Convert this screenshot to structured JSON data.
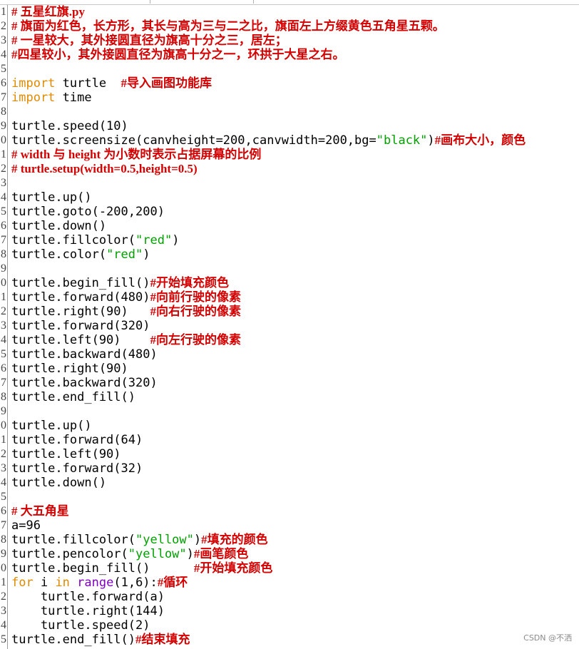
{
  "editor": {
    "watermark": "CSDN @不洒",
    "lines": [
      {
        "num": "1",
        "segs": [
          {
            "t": "# 五星红旗.py",
            "c": "comment"
          }
        ]
      },
      {
        "num": "2",
        "segs": [
          {
            "t": "# 旗面为红色，长方形，其长与高为三与二之比，旗面左上方缀黄色五角星五颗。",
            "c": "comment"
          }
        ]
      },
      {
        "num": "3",
        "segs": [
          {
            "t": "# 一星较大，其外接圆直径为旗高十分之三，居左；",
            "c": "comment"
          }
        ]
      },
      {
        "num": "4",
        "segs": [
          {
            "t": "#四星较小，其外接圆直径为旗高十分之一，环拱于大星之右。",
            "c": "comment"
          }
        ]
      },
      {
        "num": "5",
        "segs": []
      },
      {
        "num": "6",
        "segs": [
          {
            "t": "import",
            "c": "kw"
          },
          {
            "t": " turtle  ",
            "c": "plain"
          },
          {
            "t": "#导入画图功能库",
            "c": "comment"
          }
        ]
      },
      {
        "num": "7",
        "segs": [
          {
            "t": "import",
            "c": "kw"
          },
          {
            "t": " time",
            "c": "plain"
          }
        ]
      },
      {
        "num": "8",
        "segs": []
      },
      {
        "num": "9",
        "segs": [
          {
            "t": "turtle.speed(10)",
            "c": "plain"
          }
        ]
      },
      {
        "num": "0",
        "segs": [
          {
            "t": "turtle.screensize(canvheight=200,canvwidth=200,bg=",
            "c": "plain"
          },
          {
            "t": "\"black\"",
            "c": "str"
          },
          {
            "t": ")",
            "c": "plain"
          },
          {
            "t": "#画布大小，颜色",
            "c": "comment"
          }
        ]
      },
      {
        "num": "1",
        "segs": [
          {
            "t": "# width 与 height 为小数时表示占据屏幕的比例",
            "c": "comment"
          }
        ]
      },
      {
        "num": "2",
        "segs": [
          {
            "t": "# turtle.setup(width=0.5,height=0.5)",
            "c": "comment"
          }
        ]
      },
      {
        "num": "3",
        "segs": []
      },
      {
        "num": "4",
        "segs": [
          {
            "t": "turtle.up()",
            "c": "plain"
          }
        ]
      },
      {
        "num": "5",
        "segs": [
          {
            "t": "turtle.goto(-200,200)",
            "c": "plain"
          }
        ]
      },
      {
        "num": "6",
        "segs": [
          {
            "t": "turtle.down()",
            "c": "plain"
          }
        ]
      },
      {
        "num": "7",
        "segs": [
          {
            "t": "turtle.fillcolor(",
            "c": "plain"
          },
          {
            "t": "\"red\"",
            "c": "str"
          },
          {
            "t": ")",
            "c": "plain"
          }
        ]
      },
      {
        "num": "8",
        "segs": [
          {
            "t": "turtle.color(",
            "c": "plain"
          },
          {
            "t": "\"red\"",
            "c": "str"
          },
          {
            "t": ")",
            "c": "plain"
          }
        ]
      },
      {
        "num": "9",
        "segs": []
      },
      {
        "num": "0",
        "segs": [
          {
            "t": "turtle.begin_fill()",
            "c": "plain"
          },
          {
            "t": "#开始填充颜色",
            "c": "comment"
          }
        ]
      },
      {
        "num": "1",
        "segs": [
          {
            "t": "turtle.forward(480)",
            "c": "plain"
          },
          {
            "t": "#向前行驶的像素",
            "c": "comment"
          }
        ]
      },
      {
        "num": "2",
        "segs": [
          {
            "t": "turtle.right(90)   ",
            "c": "plain"
          },
          {
            "t": "#向右行驶的像素",
            "c": "comment"
          }
        ]
      },
      {
        "num": "3",
        "segs": [
          {
            "t": "turtle.forward(320)",
            "c": "plain"
          }
        ]
      },
      {
        "num": "4",
        "segs": [
          {
            "t": "turtle.left(90)    ",
            "c": "plain"
          },
          {
            "t": "#向左行驶的像素",
            "c": "comment"
          }
        ]
      },
      {
        "num": "5",
        "segs": [
          {
            "t": "turtle.backward(480)",
            "c": "plain"
          }
        ]
      },
      {
        "num": "6",
        "segs": [
          {
            "t": "turtle.right(90)",
            "c": "plain"
          }
        ]
      },
      {
        "num": "7",
        "segs": [
          {
            "t": "turtle.backward(320)",
            "c": "plain"
          }
        ]
      },
      {
        "num": "8",
        "segs": [
          {
            "t": "turtle.end_fill()",
            "c": "plain"
          }
        ]
      },
      {
        "num": "9",
        "segs": []
      },
      {
        "num": "0",
        "segs": [
          {
            "t": "turtle.up()",
            "c": "plain"
          }
        ]
      },
      {
        "num": "1",
        "segs": [
          {
            "t": "turtle.forward(64)",
            "c": "plain"
          }
        ]
      },
      {
        "num": "2",
        "segs": [
          {
            "t": "turtle.left(90)",
            "c": "plain"
          }
        ]
      },
      {
        "num": "3",
        "segs": [
          {
            "t": "turtle.forward(32)",
            "c": "plain"
          }
        ]
      },
      {
        "num": "4",
        "segs": [
          {
            "t": "turtle.down()",
            "c": "plain"
          }
        ]
      },
      {
        "num": "5",
        "segs": []
      },
      {
        "num": "6",
        "segs": [
          {
            "t": "# 大五角星",
            "c": "comment"
          }
        ]
      },
      {
        "num": "7",
        "segs": [
          {
            "t": "a=96",
            "c": "plain"
          }
        ]
      },
      {
        "num": "8",
        "segs": [
          {
            "t": "turtle.fillcolor(",
            "c": "plain"
          },
          {
            "t": "\"yellow\"",
            "c": "str"
          },
          {
            "t": ")",
            "c": "plain"
          },
          {
            "t": "#填充的颜色",
            "c": "comment"
          }
        ]
      },
      {
        "num": "9",
        "segs": [
          {
            "t": "turtle.pencolor(",
            "c": "plain"
          },
          {
            "t": "\"yellow\"",
            "c": "str"
          },
          {
            "t": ")",
            "c": "plain"
          },
          {
            "t": "#画笔颜色",
            "c": "comment"
          }
        ]
      },
      {
        "num": "0",
        "segs": [
          {
            "t": "turtle.begin_fill()      ",
            "c": "plain"
          },
          {
            "t": "#开始填充颜色",
            "c": "comment"
          }
        ]
      },
      {
        "num": "1",
        "segs": [
          {
            "t": "for",
            "c": "kw"
          },
          {
            "t": " i ",
            "c": "plain"
          },
          {
            "t": "in",
            "c": "kw"
          },
          {
            "t": " ",
            "c": "plain"
          },
          {
            "t": "range",
            "c": "kw2"
          },
          {
            "t": "(1,6):",
            "c": "plain"
          },
          {
            "t": "#循环",
            "c": "comment"
          }
        ]
      },
      {
        "num": "2",
        "segs": [
          {
            "t": "    turtle.forward(a)",
            "c": "plain"
          }
        ]
      },
      {
        "num": "3",
        "segs": [
          {
            "t": "    turtle.right(144)",
            "c": "plain"
          }
        ]
      },
      {
        "num": "4",
        "segs": [
          {
            "t": "    turtle.speed(2)",
            "c": "plain"
          }
        ]
      },
      {
        "num": "5",
        "segs": [
          {
            "t": "turtle.end_fill()",
            "c": "plain"
          },
          {
            "t": "#结束填充",
            "c": "comment"
          }
        ]
      }
    ]
  }
}
